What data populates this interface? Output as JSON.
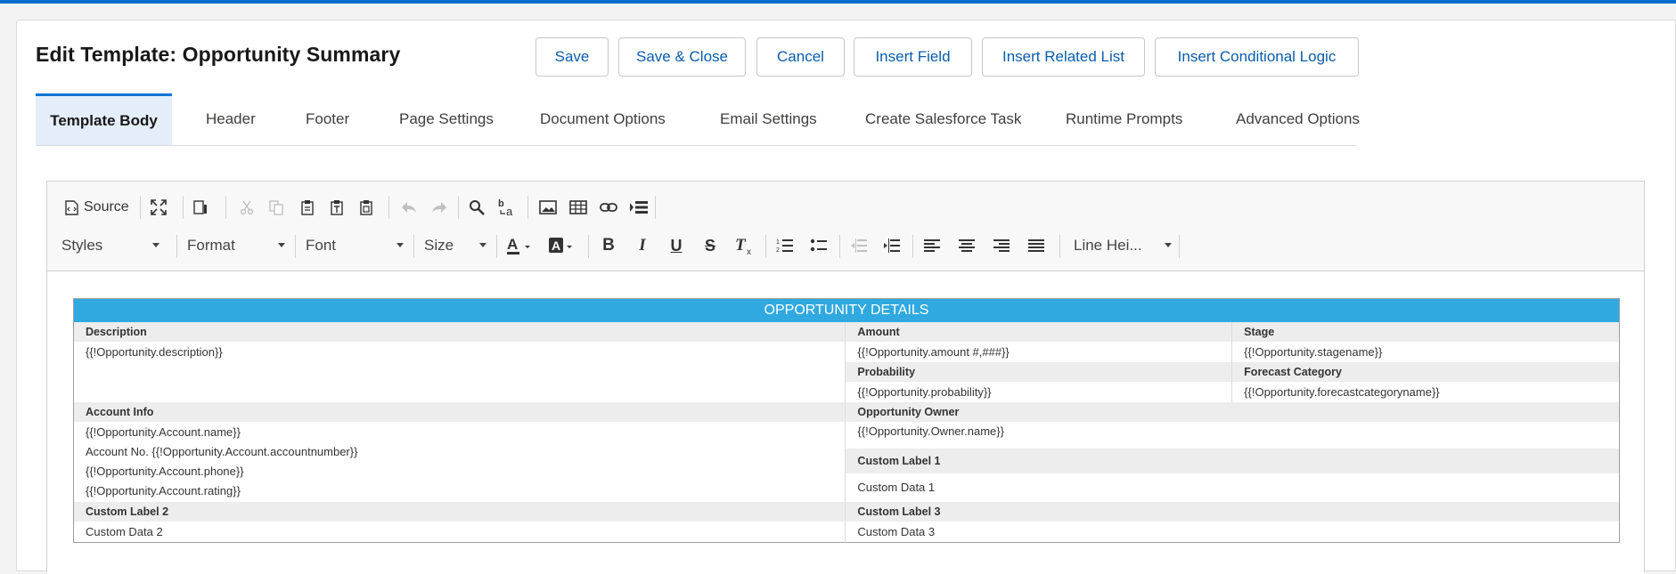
{
  "page": {
    "title": "Edit Template: Opportunity Summary"
  },
  "buttons": {
    "save": "Save",
    "save_close": "Save & Close",
    "cancel": "Cancel",
    "insert_field": "Insert Field",
    "insert_related_list": "Insert Related List",
    "insert_conditional_logic": "Insert Conditional Logic"
  },
  "tabs": [
    {
      "label": "Template Body",
      "active": true
    },
    {
      "label": "Header"
    },
    {
      "label": "Footer"
    },
    {
      "label": "Page Settings"
    },
    {
      "label": "Document Options"
    },
    {
      "label": "Email Settings"
    },
    {
      "label": "Create Salesforce Task"
    },
    {
      "label": "Runtime Prompts"
    },
    {
      "label": "Advanced Options"
    }
  ],
  "editor": {
    "source_label": "Source",
    "icons_row1": [
      "source-icon",
      "maximize-icon",
      "show-blocks-icon",
      "cut-icon",
      "copy-icon",
      "paste-icon",
      "paste-text-icon",
      "paste-word-icon",
      "undo-icon",
      "redo-icon",
      "find-icon",
      "replace-icon",
      "image-icon",
      "table-icon",
      "link-icon",
      "page-break-icon"
    ],
    "icons_row2": [
      "text-color-icon",
      "background-color-icon",
      "bold-icon",
      "italic-icon",
      "underline-icon",
      "strikethrough-icon",
      "remove-format-icon",
      "numbered-list-icon",
      "bulleted-list-icon",
      "decrease-indent-icon",
      "increase-indent-icon",
      "align-left-icon",
      "align-center-icon",
      "align-right-icon",
      "justify-icon"
    ],
    "combos": {
      "styles": "Styles",
      "format": "Format",
      "font": "Font",
      "size": "Size",
      "line_height": "Line Hei..."
    }
  },
  "document": {
    "header": "OPPORTUNITY DETAILS",
    "description_label": "Description",
    "description_value": "{{!Opportunity.description}}",
    "amount_label": "Amount",
    "amount_value": "{{!Opportunity.amount #,###}}",
    "stage_label": "Stage",
    "stage_value": "{{!Opportunity.stagename}}",
    "probability_label": "Probability",
    "probability_value": "{{!Opportunity.probability}}",
    "forecast_label": "Forecast Category",
    "forecast_value": "{{!Opportunity.forecastcategoryname}}",
    "account_label": "Account Info",
    "account_lines": [
      "{{!Opportunity.Account.name}}",
      "Account No. {{!Opportunity.Account.accountnumber}}",
      "{{!Opportunity.Account.phone}}",
      "{{!Opportunity.Account.rating}}"
    ],
    "owner_label": "Opportunity Owner",
    "owner_value": "{{!Opportunity.Owner.name}}",
    "custom_label_1": "Custom Label 1",
    "custom_data_1": "Custom Data 1",
    "custom_label_2": "Custom Label 2",
    "custom_data_2": "Custom Data 2",
    "custom_label_3": "Custom Label 3",
    "custom_data_3": "Custom Data 3"
  },
  "colors": {
    "accent": "#0176d3",
    "link": "#0b5cab",
    "table_header": "#2fa9e0",
    "topbar": "#0b6dd0"
  }
}
